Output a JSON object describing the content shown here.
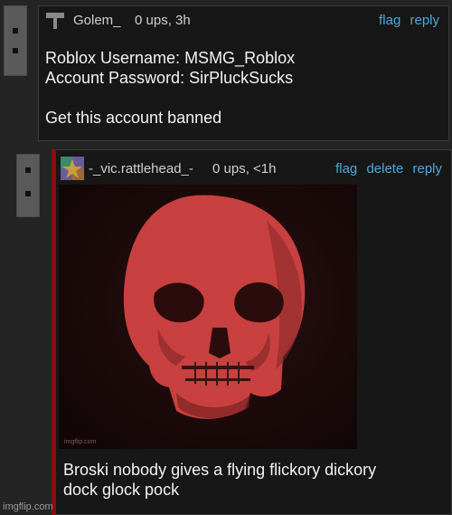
{
  "comment1": {
    "username": "Golem_",
    "ups": "0 ups, 3h",
    "actions": {
      "flag": "flag",
      "reply": "reply"
    },
    "body": "Roblox Username: MSMG_Roblox\nAccount Password: SirPluckSucks\n\nGet this account banned"
  },
  "comment2": {
    "username": "-_vic.rattlehead_-",
    "ups": "0 ups, <1h",
    "actions": {
      "flag": "flag",
      "delete": "delete",
      "reply": "reply"
    },
    "image_watermark": "imgflip.com",
    "body": "Broski nobody gives a flying flickory dickory\ndock glock pock"
  },
  "site_watermark": "imgflip.com",
  "colors": {
    "link": "#4aa8e0",
    "reply_bar": "#8a0c10",
    "skull": "#c8403f"
  }
}
